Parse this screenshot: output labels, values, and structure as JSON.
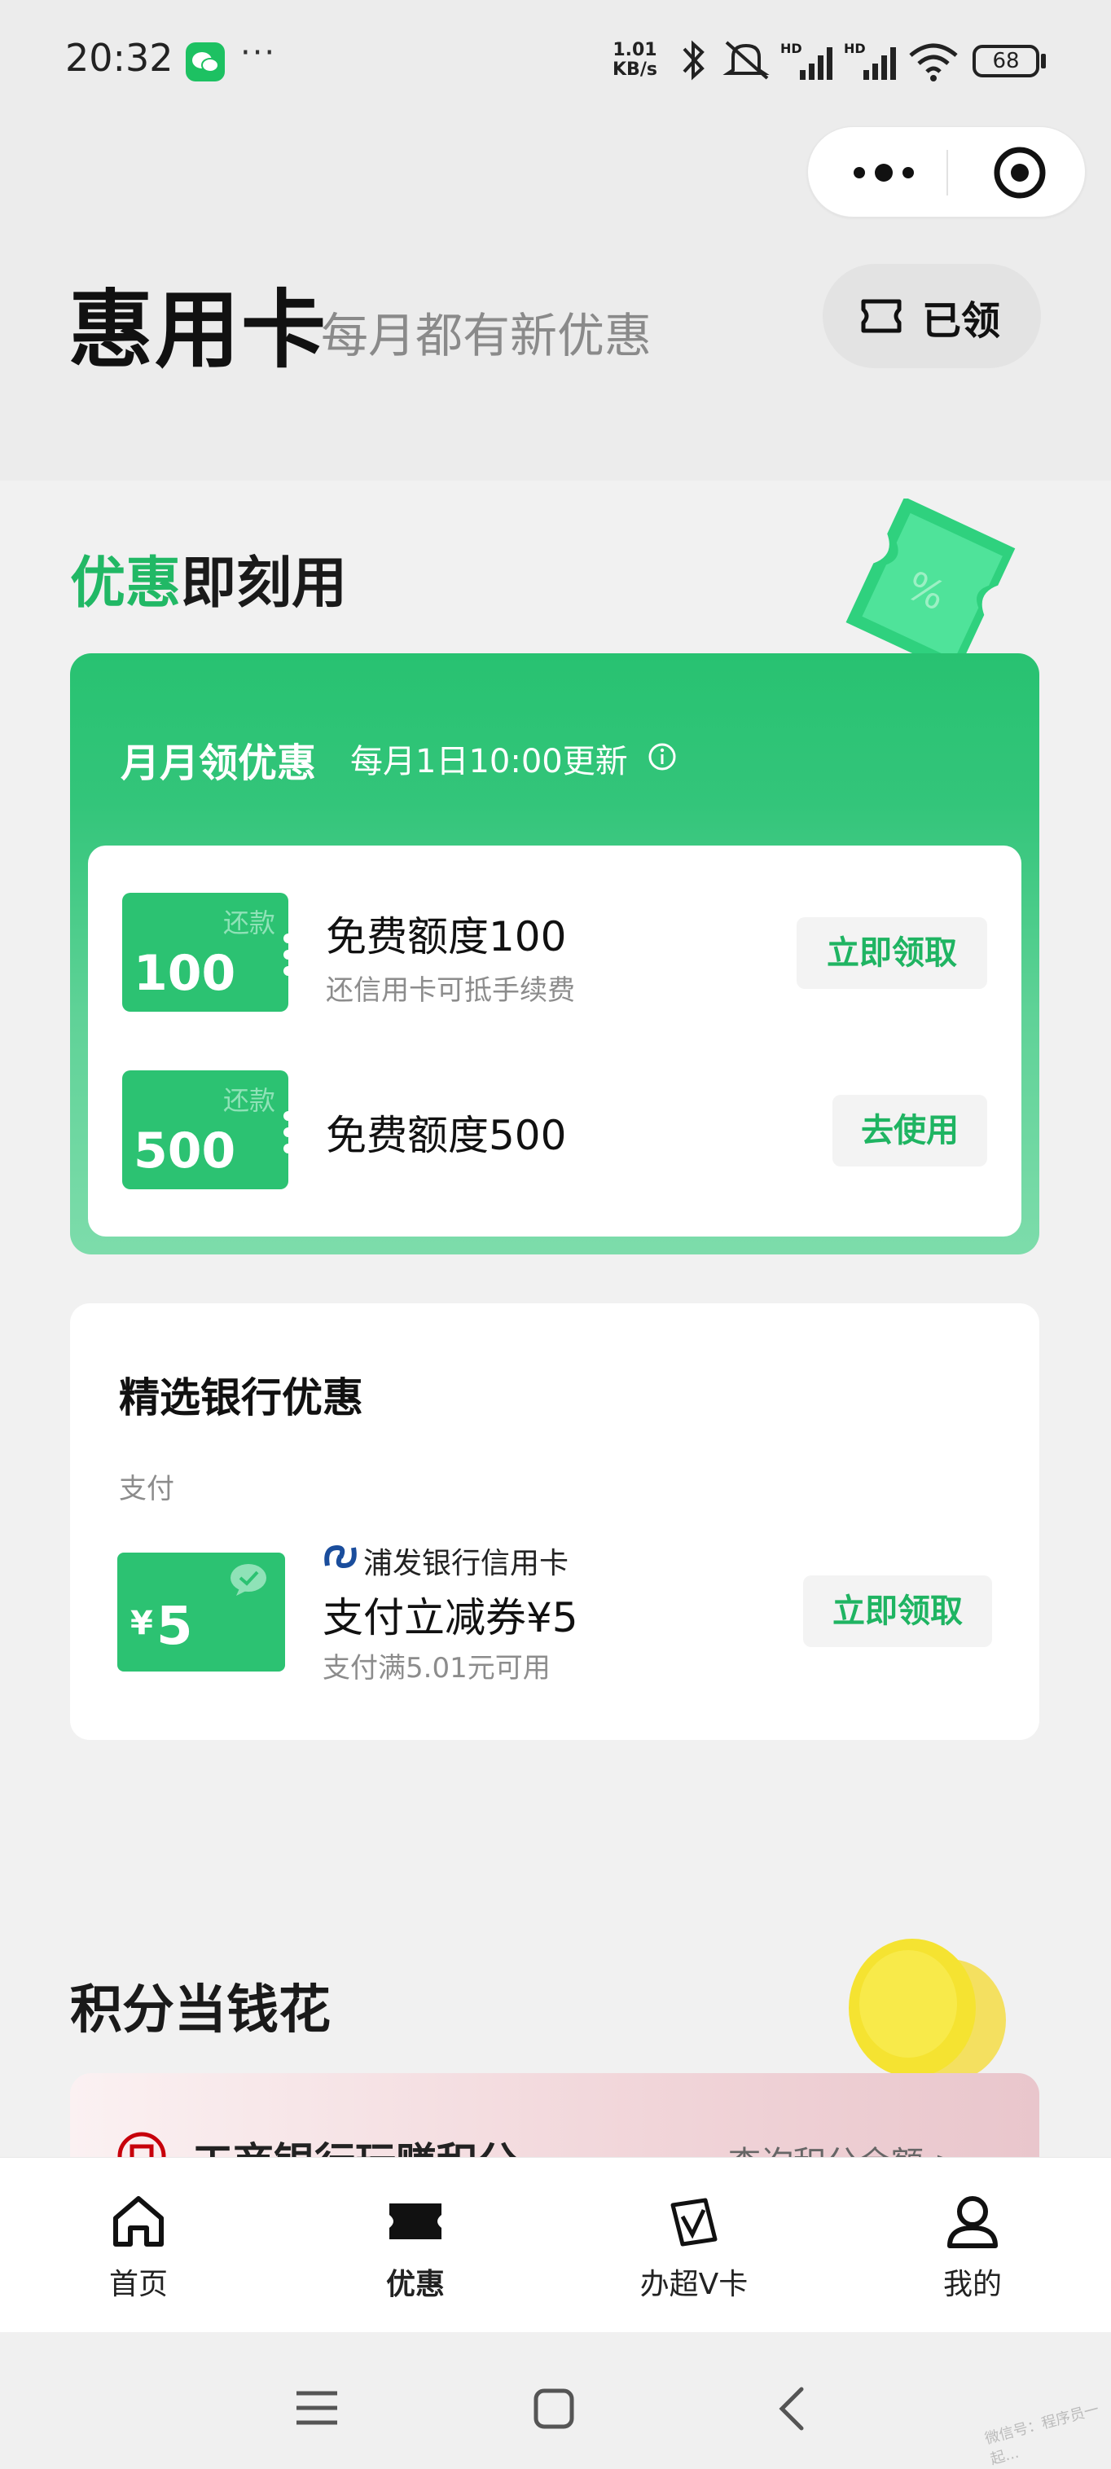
{
  "status_bar": {
    "time": "20:32",
    "more": "···",
    "net_speed_value": "1.01",
    "net_speed_unit": "KB/s",
    "signal_label_1": "HD",
    "signal_label_2": "HD",
    "battery": "68",
    "icons": [
      "wechat-icon",
      "bluetooth-icon",
      "mute-icon",
      "signal-icon",
      "signal-icon",
      "wifi-icon",
      "battery-icon"
    ]
  },
  "header": {
    "title": "惠用卡",
    "subtitle": "每月都有新优惠",
    "claimed_label": "已领"
  },
  "section_instant": {
    "title_highlight": "优惠",
    "title_rest": "即刻用"
  },
  "promo": {
    "heading": "月月领优惠",
    "update_note": "每月1日10:00更新",
    "items": [
      {
        "tag": "还款",
        "amount": "100",
        "title": "免费额度100",
        "desc": "还信用卡可抵手续费",
        "action": "立即领取"
      },
      {
        "tag": "还款",
        "amount": "500",
        "title": "免费额度500",
        "desc": "",
        "action": "去使用"
      }
    ]
  },
  "bank_offers": {
    "title": "精选银行优惠",
    "category": "支付",
    "coupon_currency": "¥",
    "coupon_amount": "5",
    "bank_name": "浦发银行信用卡",
    "offer_title": "支付立减券¥5",
    "offer_desc": "支付满5.01元可用",
    "action": "立即领取"
  },
  "points": {
    "title": "积分当钱花",
    "row_title": "工商银行玩赚积分",
    "row_link": "查询积分余额 >"
  },
  "tabbar": {
    "items": [
      {
        "label": "首页",
        "icon": "home-icon",
        "active": false
      },
      {
        "label": "优惠",
        "icon": "ticket-icon",
        "active": true
      },
      {
        "label": "办超V卡",
        "icon": "cards-icon",
        "active": false
      },
      {
        "label": "我的",
        "icon": "user-icon",
        "active": false
      }
    ]
  },
  "navbar": {
    "icons": [
      "menu-icon",
      "home-square-icon",
      "back-icon"
    ]
  },
  "watermark": "微信号：程序员一起..."
}
